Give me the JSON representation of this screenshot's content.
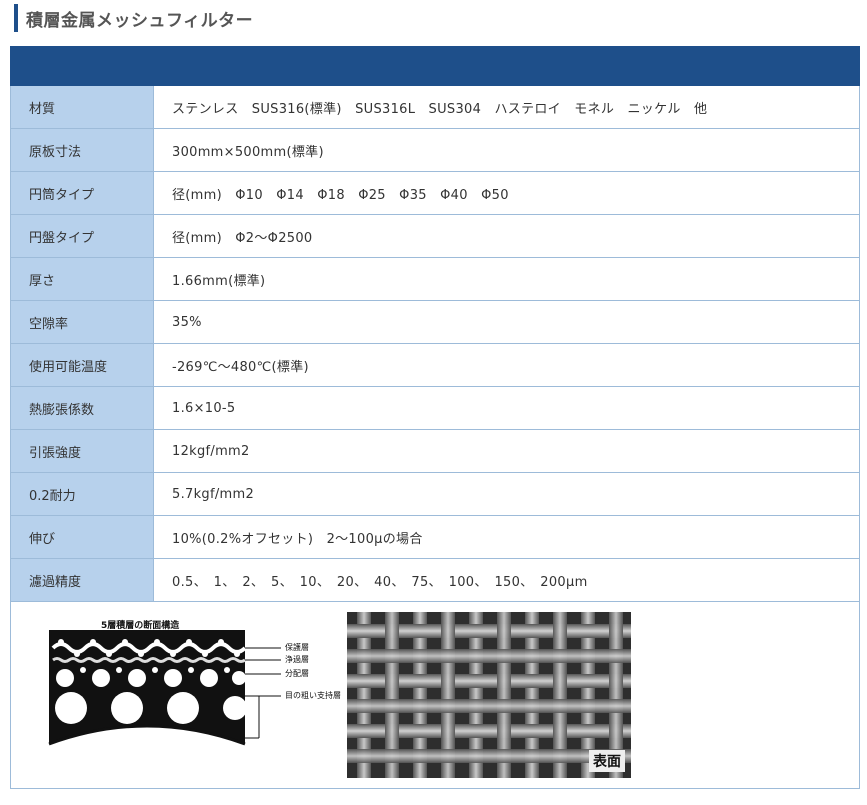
{
  "page": {
    "title": "積層金属メッシュフィルター"
  },
  "spec": {
    "rows": [
      {
        "label": "材質",
        "value": "ステンレス　SUS316(標準)　SUS316L　SUS304　ハステロイ　モネル　ニッケル　他"
      },
      {
        "label": "原板寸法",
        "value": "300mm×500mm(標準)"
      },
      {
        "label": "円筒タイプ",
        "value": "径(mm)　Φ10　Φ14　Φ18　Φ25　Φ35　Φ40　Φ50"
      },
      {
        "label": "円盤タイプ",
        "value": "径(mm)　Φ2～Φ2500"
      },
      {
        "label": "厚さ",
        "value": "1.66mm(標準)"
      },
      {
        "label": "空隙率",
        "value": "35%"
      },
      {
        "label": "使用可能温度",
        "value": "-269℃～480℃(標準)"
      },
      {
        "label": "熱膨張係数",
        "value": "1.6×10-5"
      },
      {
        "label": "引張強度",
        "value": "12kgf/mm2"
      },
      {
        "label": "0.2耐力",
        "value": "5.7kgf/mm2"
      },
      {
        "label": "伸び",
        "value": "10%(0.2%オフセット)　2～100μの場合"
      },
      {
        "label": "濾過精度",
        "value": "0.5、　1、　2、　5、　10、　20、　40、　75、　100、　150、　200μm"
      }
    ]
  },
  "figure": {
    "diagram_title": "5層積層の断面構造",
    "callouts": [
      "保護層",
      "浄過層",
      "分配層",
      "目の粗い支持層"
    ],
    "photo_label": "表面"
  }
}
